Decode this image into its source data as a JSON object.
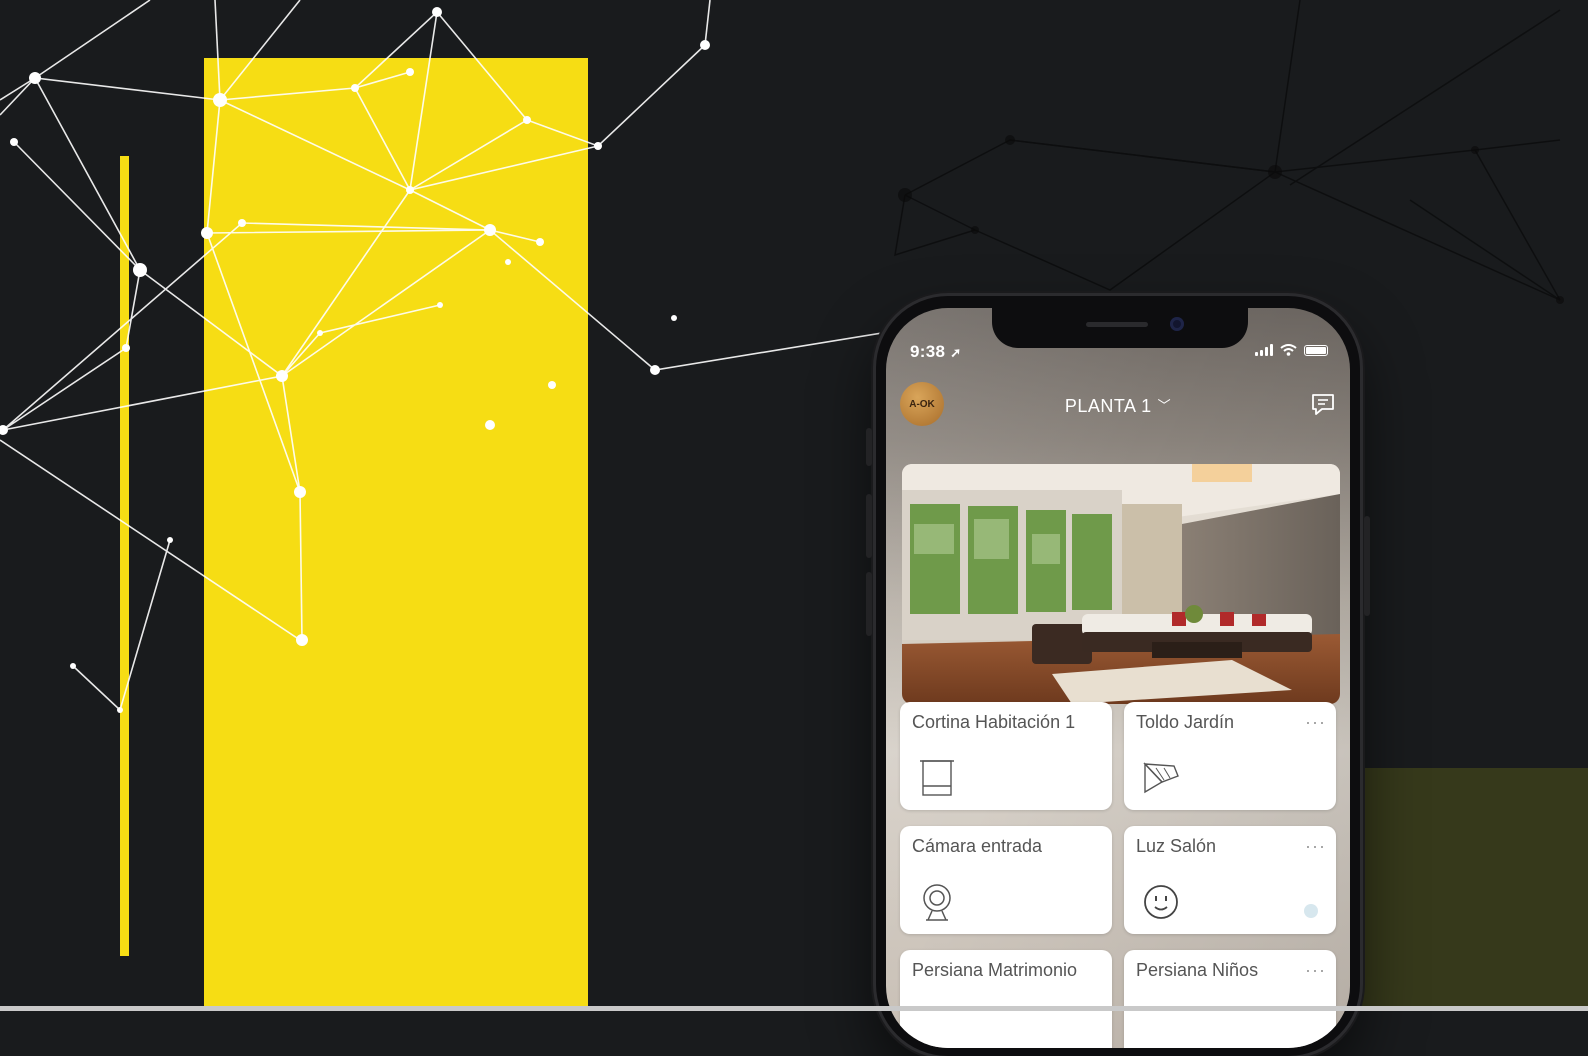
{
  "status_bar": {
    "time": "9:38"
  },
  "header": {
    "floor_title": "PLANTA 1",
    "avatar_text": "A-OK"
  },
  "devices": [
    {
      "label": "Cortina Habitación 1",
      "icon": "curtain-icon",
      "more": ""
    },
    {
      "label": "Toldo Jardín",
      "icon": "awning-icon",
      "more": "···"
    },
    {
      "label": "Cámara entrada",
      "icon": "webcam-icon",
      "more": ""
    },
    {
      "label": "Luz Salón",
      "icon": "socket-icon",
      "more": "···"
    },
    {
      "label": "Persiana Matrimonio",
      "icon": "blind-icon",
      "more": ""
    },
    {
      "label": "Persiana Niños",
      "icon": "blind-icon",
      "more": "···"
    }
  ],
  "colors": {
    "accent_yellow": "#f6dd14",
    "background": "#191b1d",
    "olive": "#36391b"
  }
}
